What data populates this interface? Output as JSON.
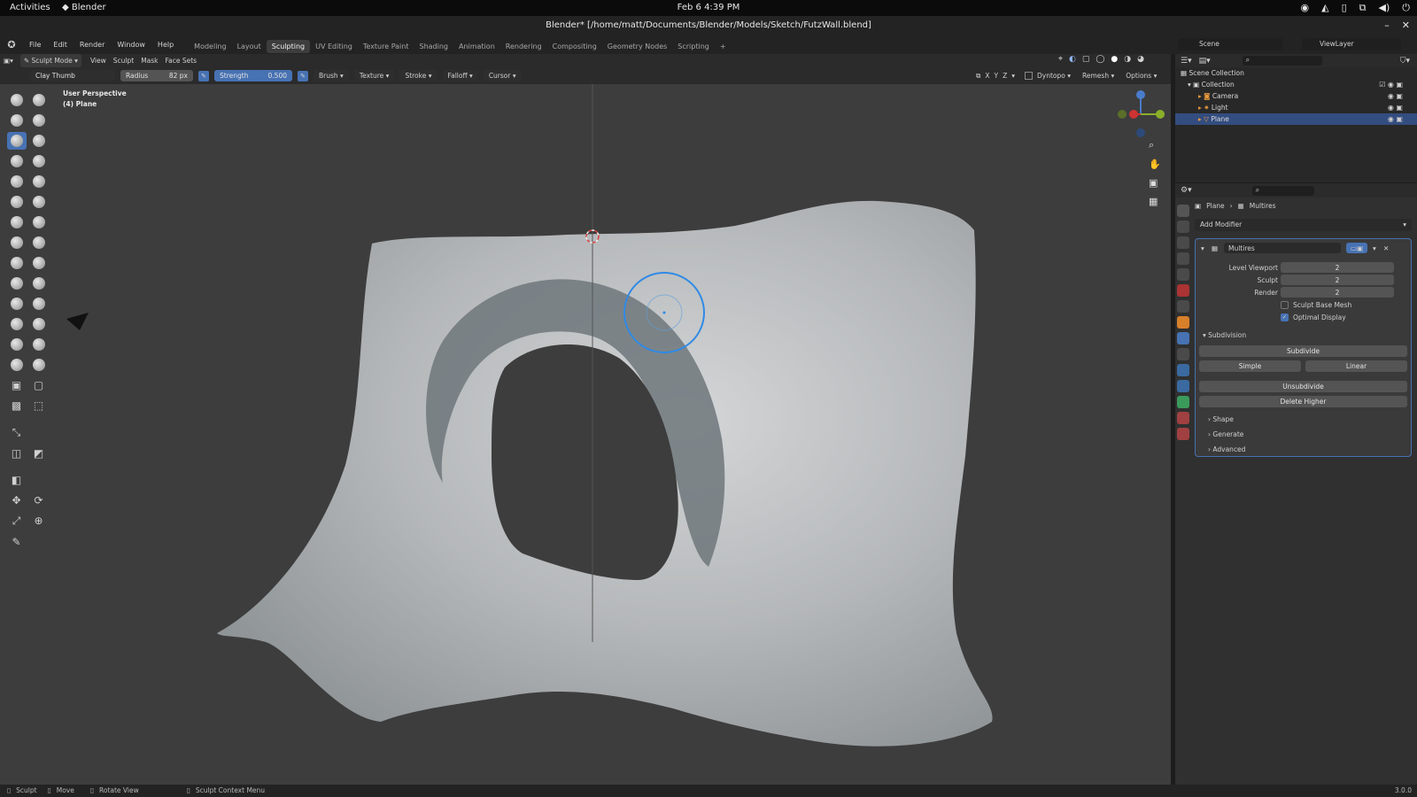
{
  "system_bar": {
    "activities": "Activities",
    "app_name": "Blender",
    "clock": "Feb 6  4:39 PM"
  },
  "window": {
    "title": "Blender* [/home/matt/Documents/Blender/Models/Sketch/FutzWall.blend]"
  },
  "menu": {
    "items": [
      "File",
      "Edit",
      "Render",
      "Window",
      "Help"
    ],
    "workspaces": [
      "Modeling",
      "Layout",
      "Sculpting",
      "UV Editing",
      "Texture Paint",
      "Shading",
      "Animation",
      "Rendering",
      "Compositing",
      "Geometry Nodes",
      "Scripting"
    ],
    "active_workspace": "Sculpting",
    "add_tab": "+",
    "scene_label": "Scene",
    "view_layer_label": "ViewLayer"
  },
  "viewport_header": {
    "mode": "Sculpt Mode",
    "menus": [
      "View",
      "Sculpt",
      "Mask",
      "Face Sets"
    ]
  },
  "tool_header": {
    "brush_name": "Clay Thumb",
    "radius_label": "Radius",
    "radius_value": "82 px",
    "strength_label": "Strength",
    "strength_value": "0.500",
    "dropdowns": [
      "Brush",
      "Texture",
      "Stroke",
      "Falloff",
      "Cursor"
    ],
    "axis_x": "X",
    "axis_y": "Y",
    "axis_z": "Z",
    "dyntopo": "Dyntopo",
    "remesh": "Remesh",
    "options": "Options"
  },
  "viewport": {
    "perspective_label": "User Perspective",
    "object_label": "(4) Plane",
    "background": "#3d3d3d",
    "mesh_color": "#b9bcbd"
  },
  "outliner": {
    "root": "Scene Collection",
    "collection": "Collection",
    "objects": [
      {
        "name": "Camera",
        "icon": "camera-icon",
        "selected": false
      },
      {
        "name": "Light",
        "icon": "light-icon",
        "selected": false
      },
      {
        "name": "Plane",
        "icon": "mesh-icon",
        "selected": true
      }
    ]
  },
  "properties": {
    "breadcrumb_object": "Plane",
    "breadcrumb_modifier": "Multires",
    "add_modifier": "Add Modifier",
    "modifier_name": "Multires",
    "level_viewport_label": "Level Viewport",
    "level_viewport_value": "2",
    "sculpt_label": "Sculpt",
    "sculpt_value": "2",
    "render_label": "Render",
    "render_value": "2",
    "sculpt_base_mesh": "Sculpt Base Mesh",
    "optimal_display": "Optimal Display",
    "subdivision_section": "Subdivision",
    "subdivide_btn": "Subdivide",
    "simple_btn": "Simple",
    "linear_btn": "Linear",
    "unsubdivide_btn": "Unsubdivide",
    "delete_higher_btn": "Delete Higher",
    "shape_section": "Shape",
    "generate_section": "Generate",
    "advanced_section": "Advanced"
  },
  "status_bar": {
    "sculpt": "Sculpt",
    "move": "Move",
    "rotate": "Rotate View",
    "context": "Sculpt Context Menu",
    "version": "3.0.0"
  },
  "colors": {
    "accent": "#4772b3",
    "selection": "#334d80",
    "brush_circle": "#2f8ae6"
  }
}
